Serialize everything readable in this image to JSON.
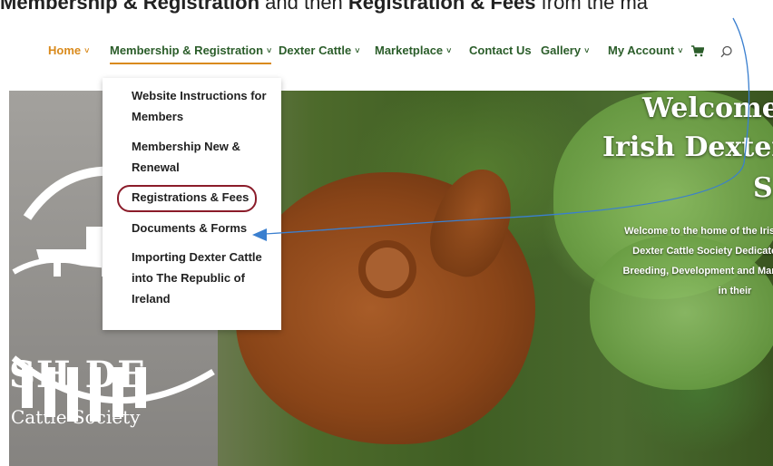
{
  "instruction": {
    "part1": "Membership & Registration",
    "part2": " and then ",
    "part3": "Registration & Fees",
    "part4": " from the ma"
  },
  "nav": {
    "items": [
      {
        "label": "Home"
      },
      {
        "label": "Membership & Registration"
      },
      {
        "label": "Dexter Cattle"
      },
      {
        "label": "Marketplace"
      },
      {
        "label": "Contact Us"
      },
      {
        "label": "Gallery"
      },
      {
        "label": "My Account"
      }
    ],
    "chevron": "˅"
  },
  "dropdown": {
    "items": [
      {
        "label": "Website Instructions for Members"
      },
      {
        "label": "Membership New & Renewal"
      },
      {
        "label": "Registrations & Fees"
      },
      {
        "label": "Documents & Forms"
      },
      {
        "label": "Importing Dexter Cattle into The Republic of Ireland"
      }
    ]
  },
  "logo": {
    "text1": "SH DE",
    "text2": "Cattle Society"
  },
  "hero": {
    "title1": "Welcome",
    "title2": "Irish Dexter",
    "title3": "S",
    "body": [
      "Welcome to the home of the Irish D",
      "Dexter Cattle Society Dedicated",
      "Breeding, Development and Marketi",
      "in their"
    ]
  },
  "colors": {
    "nav_text": "#2b5d2a",
    "nav_active": "#d98a1c",
    "highlight_circle": "#8b1c2a",
    "annotation_line": "#3a7fcf"
  }
}
